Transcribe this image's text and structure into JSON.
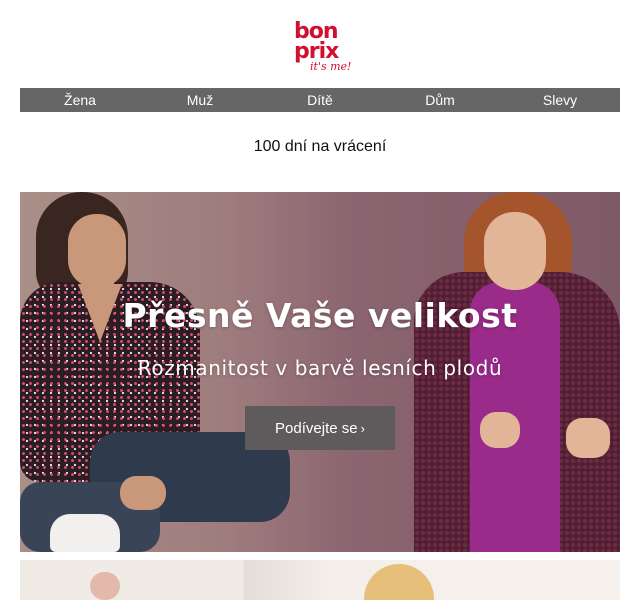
{
  "brand": {
    "logo_line1": "bon",
    "logo_line2": "prix",
    "logo_tagline": "it's me!",
    "color": "#d0102e"
  },
  "nav": {
    "items": [
      {
        "label": "Žena"
      },
      {
        "label": "Muž"
      },
      {
        "label": "Dítě"
      },
      {
        "label": "Dům"
      },
      {
        "label": "Slevy"
      }
    ],
    "background": "#666666"
  },
  "returns": {
    "text": "100 dní na vrácení"
  },
  "hero": {
    "title": "Přesně Vaše velikost",
    "subtitle": "Rozmanitost v barvě lesních plodů",
    "cta_label": "Podívejte se",
    "cta_arrow": "›",
    "cta_color": "#5f5a5c"
  }
}
